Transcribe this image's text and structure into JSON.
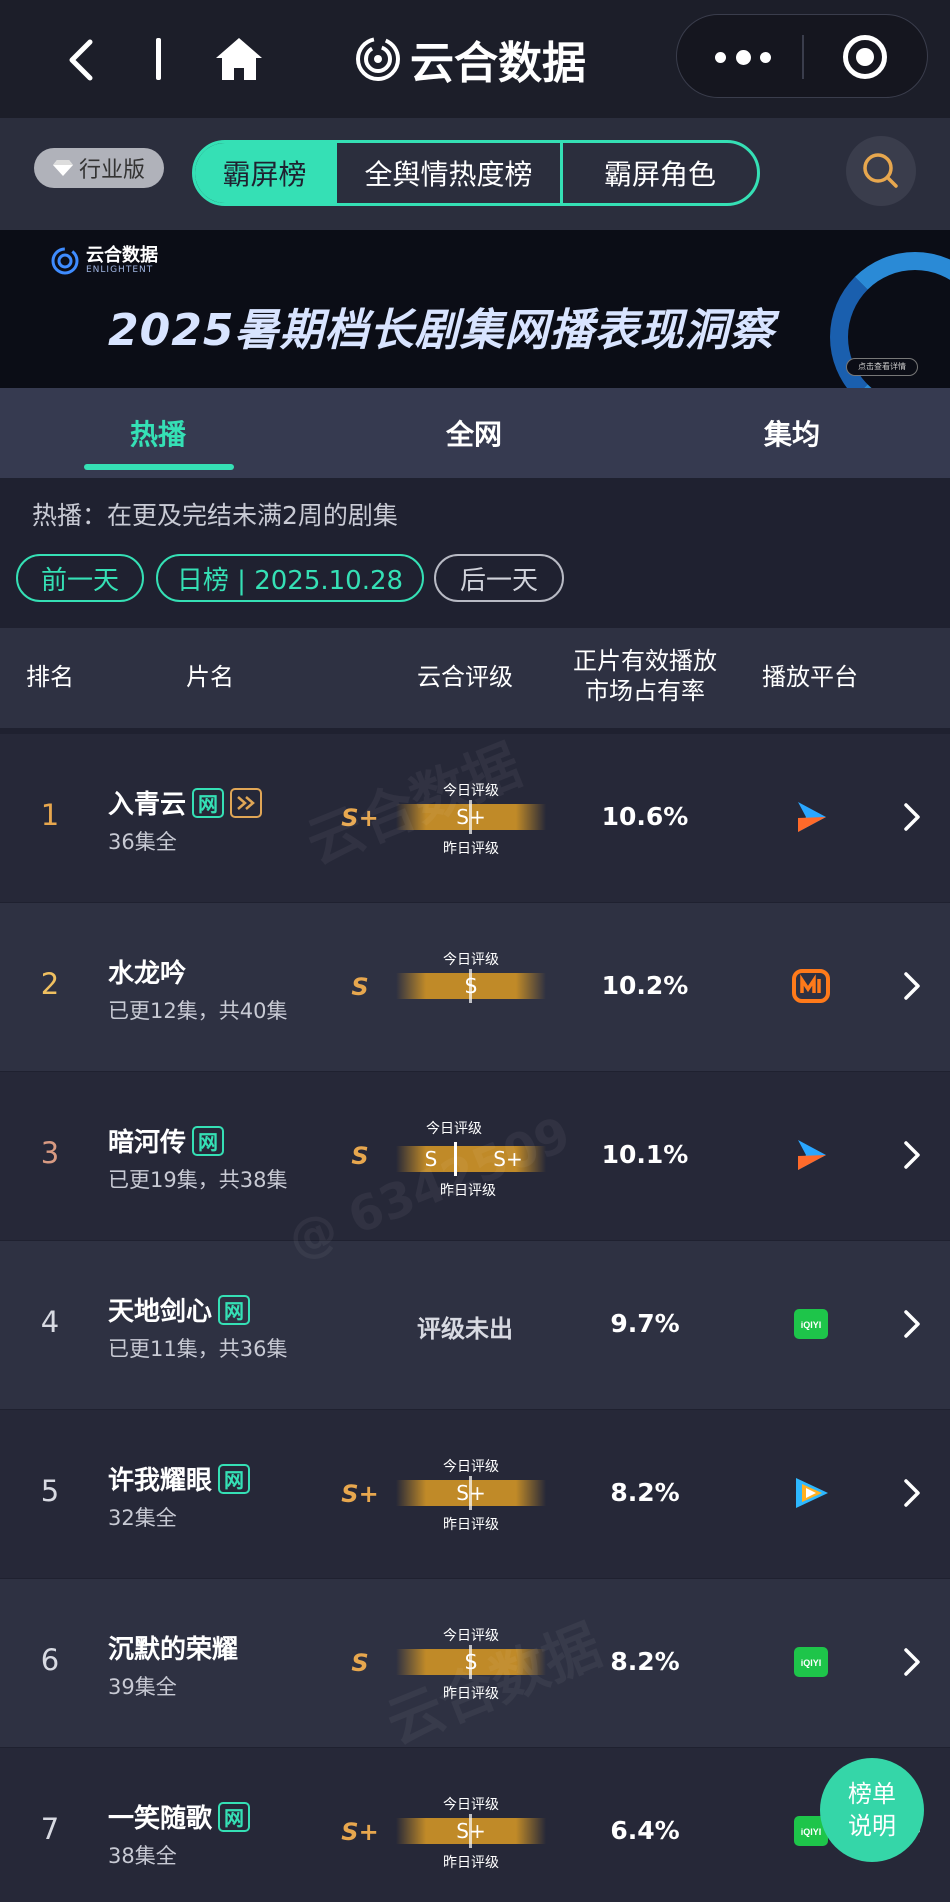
{
  "app": {
    "title": "云合数据"
  },
  "subheader": {
    "edition_label": "行业版",
    "tabs": [
      {
        "label": "霸屏榜",
        "active": true
      },
      {
        "label": "全舆情热度榜",
        "active": false
      },
      {
        "label": "霸屏角色",
        "active": false
      }
    ]
  },
  "banner": {
    "logo_text": "云合数据",
    "logo_sub": "ENLIGHTENT",
    "title": "2025暑期档长剧集网播表现洞察",
    "link_label": "点击查看详情"
  },
  "main_tabs": [
    {
      "label": "热播",
      "active": true
    },
    {
      "label": "全网",
      "active": false
    },
    {
      "label": "集均",
      "active": false
    }
  ],
  "note": "热播：在更及完结未满2周的剧集",
  "date_nav": {
    "prev_label": "前一天",
    "current_label": "日榜 | 2025.10.28",
    "next_label": "后一天"
  },
  "table": {
    "headers": {
      "rank": "排名",
      "title": "片名",
      "grade": "云合评级",
      "share_line1": "正片有效播放",
      "share_line2": "市场占有率",
      "platform": "播放平台"
    },
    "grade_caption_today": "今日评级",
    "grade_caption_yesterday": "昨日评级",
    "rows": [
      {
        "rank": "1",
        "name": "入青云",
        "net_tag": "网",
        "vip_tag": true,
        "episodes": "36集全",
        "grade": "S+",
        "grade_today": "S+",
        "grade_yesterday": "S+",
        "share": "10.6%",
        "platform_icon": "youku-icon",
        "rank_color": "#e7a74e"
      },
      {
        "rank": "2",
        "name": "水龙吟",
        "net_tag": "",
        "vip_tag": false,
        "episodes": "已更12集，共40集",
        "grade": "S",
        "grade_today": "S",
        "grade_yesterday": "",
        "share": "10.2%",
        "platform_icon": "mangotv-icon",
        "rank_color": "#f0c060"
      },
      {
        "rank": "3",
        "name": "暗河传",
        "net_tag": "网",
        "vip_tag": false,
        "episodes": "已更19集，共38集",
        "grade": "S",
        "grade_today": "S",
        "grade_yesterday": "S+",
        "share": "10.1%",
        "platform_icon": "youku-icon",
        "rank_color": "#d89a82"
      },
      {
        "rank": "4",
        "name": "天地剑心",
        "net_tag": "网",
        "vip_tag": false,
        "episodes": "已更11集，共36集",
        "grade": "",
        "grade_none": "评级未出",
        "share": "9.7%",
        "platform_icon": "iqiyi-icon",
        "rank_color": "#d8dae2"
      },
      {
        "rank": "5",
        "name": "许我耀眼",
        "net_tag": "网",
        "vip_tag": false,
        "episodes": "32集全",
        "grade": "S+",
        "grade_today": "S+",
        "grade_yesterday": "S+",
        "share": "8.2%",
        "platform_icon": "tencent-video-icon",
        "rank_color": "#d8dae2"
      },
      {
        "rank": "6",
        "name": "沉默的荣耀",
        "net_tag": "",
        "vip_tag": false,
        "episodes": "39集全",
        "grade": "S",
        "grade_today": "S",
        "grade_yesterday": "S",
        "share": "8.2%",
        "platform_icon": "iqiyi-icon",
        "rank_color": "#d8dae2"
      },
      {
        "rank": "7",
        "name": "一笑随歌",
        "net_tag": "网",
        "vip_tag": false,
        "episodes": "38集全",
        "grade": "S+",
        "grade_today": "S+",
        "grade_yesterday": "S+",
        "share": "6.4%",
        "platform_icon": "iqiyi-icon",
        "rank_color": "#d8dae2"
      }
    ]
  },
  "legend_button": {
    "line1": "榜单",
    "line2": "说明"
  },
  "watermarks": [
    "云合数据",
    "@ 6342509"
  ],
  "colors": {
    "accent": "#35e0b5",
    "gold": "#e7a74e",
    "bg": "#1f2130"
  }
}
